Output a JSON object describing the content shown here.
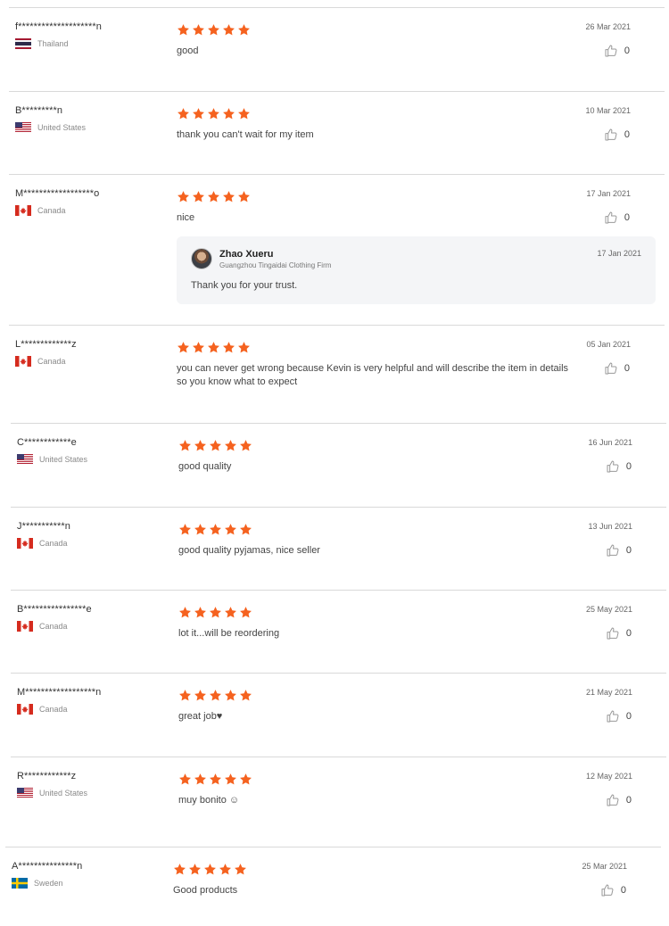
{
  "star_color": "#f5621f",
  "reviews": [
    {
      "user": "f********************n",
      "country": "Thailand",
      "flag": "thailand-flag",
      "rating": 5,
      "text": "good",
      "date": "26 Mar 2021",
      "likes": "0"
    },
    {
      "user": "B*********n",
      "country": "United States",
      "flag": "us-flag",
      "rating": 5,
      "text": "thank you can't wait for my item",
      "date": "10 Mar 2021",
      "likes": "0"
    },
    {
      "user": "M******************o",
      "country": "Canada",
      "flag": "canada-flag",
      "rating": 5,
      "text": "nice",
      "date": "17 Jan 2021",
      "likes": "0",
      "reply": {
        "name": "Zhao Xueru",
        "shop": "Guangzhou Tingaidai Clothing Firm",
        "date": "17 Jan 2021",
        "text": "Thank you for your trust."
      }
    },
    {
      "user": "L*************z",
      "country": "Canada",
      "flag": "canada-flag",
      "rating": 5,
      "text": "you can never get wrong because Kevin is very helpful and will describe the item in details so you know what to expect",
      "date": "05 Jan 2021",
      "likes": "0"
    },
    {
      "user": "C************e",
      "country": "United States",
      "flag": "us-flag",
      "rating": 5,
      "text": "good quality",
      "date": "16 Jun 2021",
      "likes": "0"
    },
    {
      "user": "J***********n",
      "country": "Canada",
      "flag": "canada-flag",
      "rating": 5,
      "text": "good quality pyjamas, nice seller",
      "date": "13 Jun 2021",
      "likes": "0"
    },
    {
      "user": "B****************e",
      "country": "Canada",
      "flag": "canada-flag",
      "rating": 5,
      "text": "lot it...will be reordering",
      "date": "25 May 2021",
      "likes": "0"
    },
    {
      "user": "M******************n",
      "country": "Canada",
      "flag": "canada-flag",
      "rating": 5,
      "text": "great job♥",
      "date": "21 May 2021",
      "likes": "0"
    },
    {
      "user": "R************z",
      "country": "United States",
      "flag": "us-flag",
      "rating": 5,
      "text": "muy bonito ☺",
      "date": "12 May 2021",
      "likes": "0"
    },
    {
      "user": "A***************n",
      "country": "Sweden",
      "flag": "sweden-flag",
      "rating": 5,
      "text": "Good products",
      "date": "25 Mar 2021",
      "likes": "0"
    }
  ]
}
